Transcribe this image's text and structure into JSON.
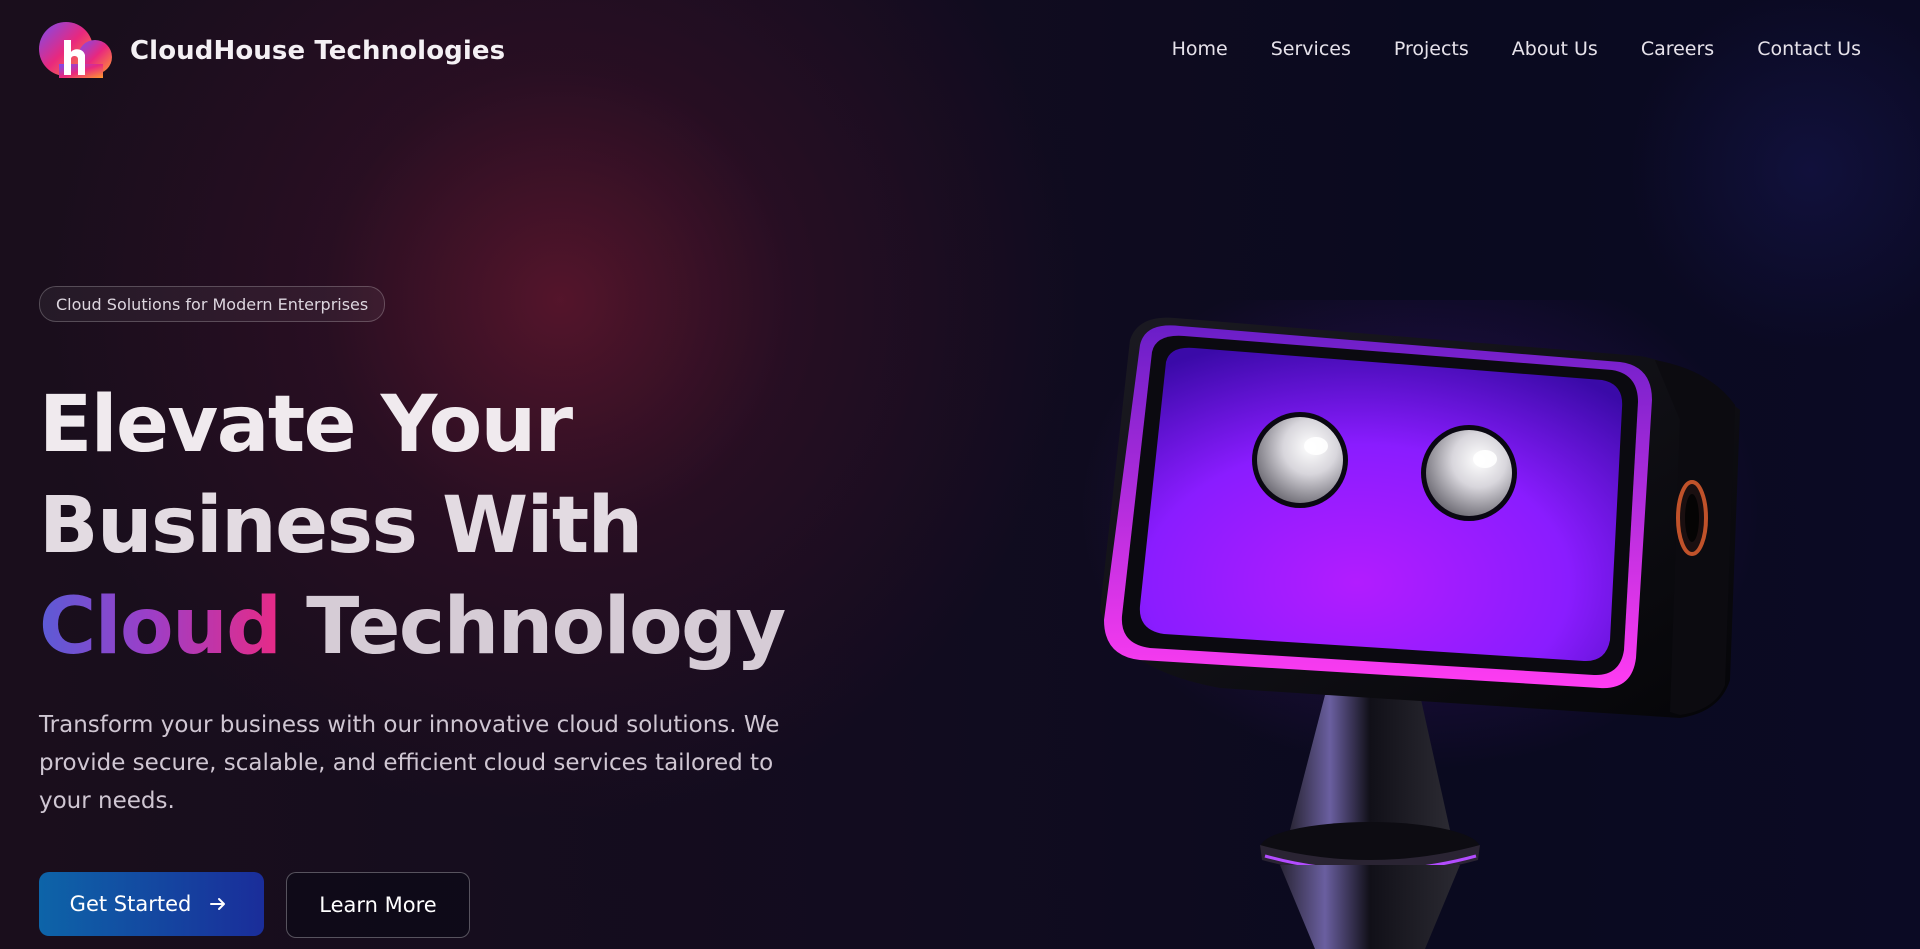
{
  "brand": {
    "name": "CloudHouse Technologies",
    "logo_icon": "cloudhouse-logo-icon"
  },
  "nav": {
    "items": [
      {
        "label": "Home"
      },
      {
        "label": "Services"
      },
      {
        "label": "Projects"
      },
      {
        "label": "About Us"
      },
      {
        "label": "Careers"
      },
      {
        "label": "Contact Us"
      }
    ]
  },
  "hero": {
    "badge": "Cloud Solutions for Modern Enterprises",
    "headline": {
      "line1": "Elevate Your",
      "line2": "Business With",
      "line3_highlight": "Cloud",
      "line3_rest": " Technology"
    },
    "description": "Transform your business with our innovative cloud solutions. We provide secure, scalable, and efficient cloud services tailored to your needs.",
    "primary_button": "Get Started",
    "primary_button_icon": "arrow-right-icon",
    "secondary_button": "Learn More",
    "illustration": "robot-tv-head-illustration"
  },
  "colors": {
    "accent_gradient_start": "#5b5bd6",
    "accent_gradient_end": "#e82a86",
    "primary_button_start": "#0d64a8",
    "primary_button_end": "#1a2d9a",
    "robot_screen": "#8a1cff"
  }
}
